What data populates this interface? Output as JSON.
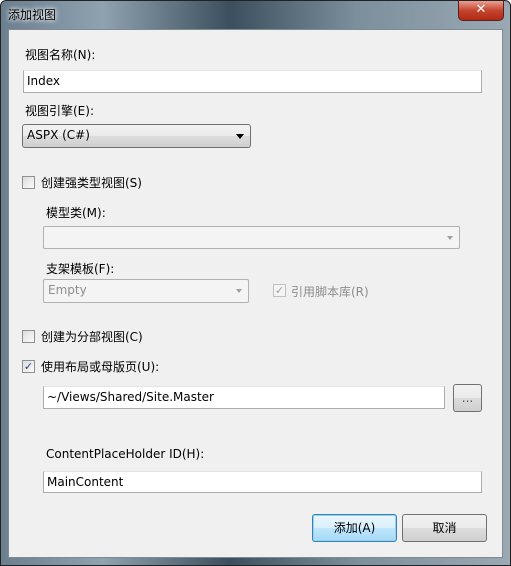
{
  "window": {
    "title": "添加视图",
    "close_icon": "close-icon"
  },
  "view_name": {
    "label": "视图名称(N):",
    "value": "Index"
  },
  "view_engine": {
    "label": "视图引擎(E):",
    "selected": "ASPX (C#)"
  },
  "strongly_typed": {
    "label": "创建强类型视图(S)",
    "checked": false
  },
  "model_class": {
    "label": "模型类(M):",
    "value": ""
  },
  "scaffold_template": {
    "label": "支架模板(F):",
    "selected": "Empty"
  },
  "reference_scripts": {
    "label": "引用脚本库(R)",
    "checked": true,
    "enabled": false
  },
  "partial_view": {
    "label": "创建为分部视图(C)",
    "checked": false
  },
  "use_layout": {
    "label": "使用布局或母版页(U):",
    "checked": true,
    "value": "~/Views/Shared/Site.Master",
    "browse_label": "..."
  },
  "content_placeholder": {
    "label": "ContentPlaceHolder ID(H):",
    "value": "MainContent"
  },
  "buttons": {
    "add": "添加(A)",
    "cancel": "取消"
  },
  "colors": {
    "dialog_bg": "#f0f0f0",
    "close_red": "#c5442e",
    "default_button_border": "#3c7fb1"
  }
}
